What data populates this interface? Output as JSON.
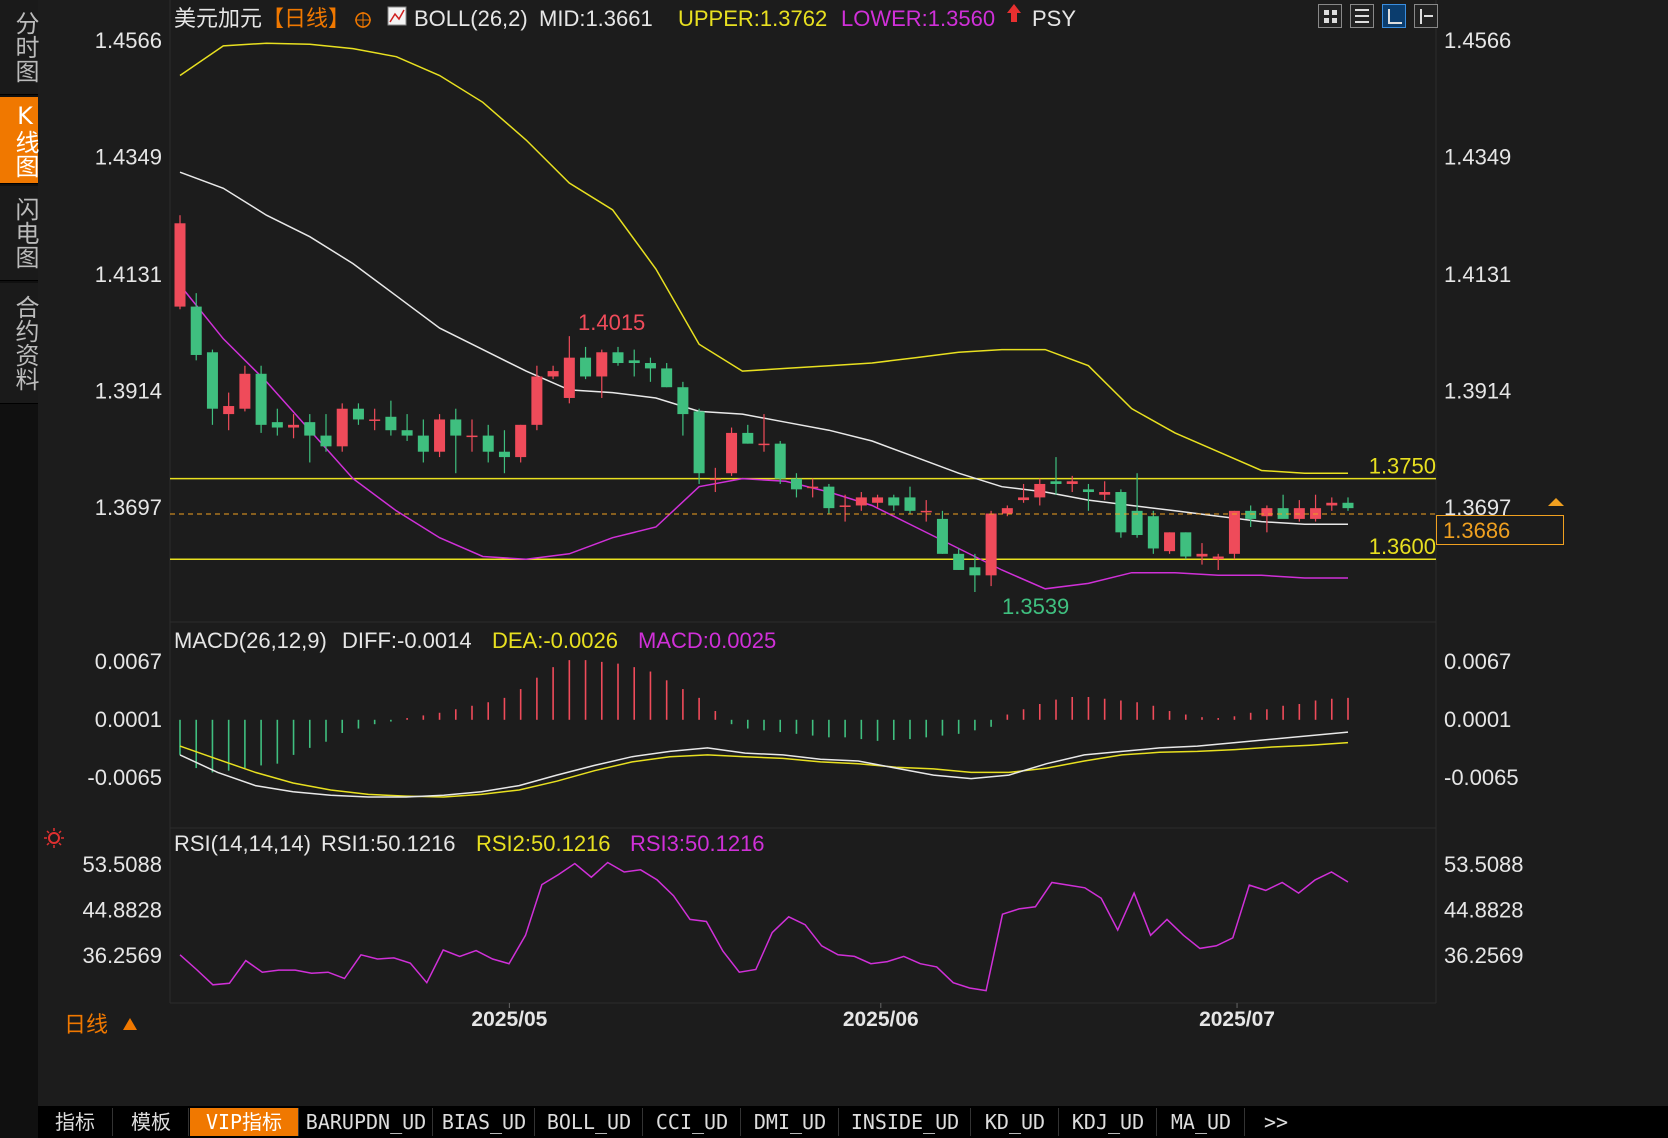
{
  "sidebar": {
    "tabs": [
      {
        "label": "分时图",
        "active": false
      },
      {
        "label": "K线图",
        "active": true
      },
      {
        "label": "闪电图",
        "active": false
      },
      {
        "label": "合约资料",
        "active": false
      }
    ]
  },
  "header": {
    "symbol": "美元加元",
    "period": "【日线】",
    "boll_label": "BOLL(26,2)",
    "mid": "MID:1.3661",
    "upper": "UPPER:1.3762",
    "lower": "LOWER:1.3560",
    "indicator": "PSY"
  },
  "colors": {
    "up": "#ef4b5a",
    "down": "#3fbf7f",
    "upper_band": "#e8e020",
    "lower_band": "#d030d8",
    "mid_band": "#e8e8e8",
    "accent": "#f07800",
    "hline": "#e8e020"
  },
  "price_axis": {
    "ticks": [
      "1.4566",
      "1.4349",
      "1.4131",
      "1.3914",
      "1.3697"
    ],
    "current": "1.3686",
    "levels": [
      "1.3750",
      "1.3600"
    ],
    "high_label": "1.4015",
    "low_label": "1.3539"
  },
  "macd": {
    "label": "MACD(26,12,9)",
    "diff": "DIFF:-0.0014",
    "dea": "DEA:-0.0026",
    "macd": "MACD:0.0025",
    "ticks": [
      "0.0067",
      "0.0001",
      "-0.0065"
    ]
  },
  "rsi": {
    "label": "RSI(14,14,14)",
    "rsi1": "RSI1:50.1216",
    "rsi2": "RSI2:50.1216",
    "rsi3": "RSI3:50.1216",
    "ticks": [
      "53.5088",
      "44.8828",
      "36.2569"
    ]
  },
  "time_axis": {
    "labels": [
      "2025/05",
      "2025/06",
      "2025/07"
    ],
    "period_label": "日线",
    "period_icon": "triangle-up-icon"
  },
  "bottom_tabs": [
    "指标",
    "模板",
    "VIP指标",
    "BARUPDN_UD",
    "BIAS_UD",
    "BOLL_UD",
    "CCI_UD",
    "DMI_UD",
    "INSIDE_UD",
    "KD_UD",
    "KDJ_UD",
    "MA_UD",
    ">>"
  ],
  "toolbar_icons": [
    "grid-icon",
    "layout-icon",
    "chart-mode-icon",
    "expand-icon"
  ],
  "chart_data": [
    {
      "type": "candlestick",
      "title": "美元加元 日线",
      "ylim": [
        1.3539,
        1.4566
      ],
      "x_labels": [
        "2025/05",
        "2025/06",
        "2025/07"
      ],
      "candles": [
        {
          "o": 1.407,
          "h": 1.424,
          "l": 1.4065,
          "c": 1.4225
        },
        {
          "o": 1.407,
          "h": 1.4095,
          "l": 1.397,
          "c": 1.398
        },
        {
          "o": 1.3985,
          "h": 1.399,
          "l": 1.385,
          "c": 1.388
        },
        {
          "o": 1.387,
          "h": 1.391,
          "l": 1.384,
          "c": 1.3885
        },
        {
          "o": 1.388,
          "h": 1.396,
          "l": 1.3875,
          "c": 1.3945
        },
        {
          "o": 1.3945,
          "h": 1.396,
          "l": 1.3835,
          "c": 1.385
        },
        {
          "o": 1.3855,
          "h": 1.388,
          "l": 1.383,
          "c": 1.3845
        },
        {
          "o": 1.3845,
          "h": 1.387,
          "l": 1.3825,
          "c": 1.385
        },
        {
          "o": 1.3855,
          "h": 1.387,
          "l": 1.378,
          "c": 1.383
        },
        {
          "o": 1.383,
          "h": 1.387,
          "l": 1.38,
          "c": 1.381
        },
        {
          "o": 1.381,
          "h": 1.389,
          "l": 1.38,
          "c": 1.388
        },
        {
          "o": 1.388,
          "h": 1.389,
          "l": 1.385,
          "c": 1.386
        },
        {
          "o": 1.386,
          "h": 1.388,
          "l": 1.384,
          "c": 1.386
        },
        {
          "o": 1.3865,
          "h": 1.3895,
          "l": 1.383,
          "c": 1.384
        },
        {
          "o": 1.384,
          "h": 1.387,
          "l": 1.382,
          "c": 1.383
        },
        {
          "o": 1.383,
          "h": 1.386,
          "l": 1.378,
          "c": 1.38
        },
        {
          "o": 1.38,
          "h": 1.387,
          "l": 1.379,
          "c": 1.386
        },
        {
          "o": 1.386,
          "h": 1.388,
          "l": 1.376,
          "c": 1.383
        },
        {
          "o": 1.383,
          "h": 1.386,
          "l": 1.38,
          "c": 1.383
        },
        {
          "o": 1.383,
          "h": 1.385,
          "l": 1.378,
          "c": 1.38
        },
        {
          "o": 1.38,
          "h": 1.384,
          "l": 1.376,
          "c": 1.379
        },
        {
          "o": 1.379,
          "h": 1.385,
          "l": 1.378,
          "c": 1.385
        },
        {
          "o": 1.385,
          "h": 1.396,
          "l": 1.384,
          "c": 1.394
        },
        {
          "o": 1.394,
          "h": 1.396,
          "l": 1.3935,
          "c": 1.395
        },
        {
          "o": 1.39,
          "h": 1.4015,
          "l": 1.389,
          "c": 1.3975
        },
        {
          "o": 1.3975,
          "h": 1.3995,
          "l": 1.3935,
          "c": 1.394
        },
        {
          "o": 1.394,
          "h": 1.399,
          "l": 1.39,
          "c": 1.3985
        },
        {
          "o": 1.3985,
          "h": 1.3995,
          "l": 1.396,
          "c": 1.3965
        },
        {
          "o": 1.397,
          "h": 1.399,
          "l": 1.394,
          "c": 1.3965
        },
        {
          "o": 1.3965,
          "h": 1.3975,
          "l": 1.393,
          "c": 1.3955
        },
        {
          "o": 1.3955,
          "h": 1.3965,
          "l": 1.392,
          "c": 1.392
        },
        {
          "o": 1.392,
          "h": 1.393,
          "l": 1.383,
          "c": 1.387
        },
        {
          "o": 1.3875,
          "h": 1.388,
          "l": 1.374,
          "c": 1.376
        },
        {
          "o": 1.375,
          "h": 1.377,
          "l": 1.3725,
          "c": 1.375
        },
        {
          "o": 1.376,
          "h": 1.3845,
          "l": 1.3755,
          "c": 1.3835
        },
        {
          "o": 1.3835,
          "h": 1.385,
          "l": 1.3815,
          "c": 1.3815
        },
        {
          "o": 1.3815,
          "h": 1.387,
          "l": 1.38,
          "c": 1.3815
        },
        {
          "o": 1.3815,
          "h": 1.382,
          "l": 1.374,
          "c": 1.375
        },
        {
          "o": 1.375,
          "h": 1.376,
          "l": 1.3715,
          "c": 1.373
        },
        {
          "o": 1.3735,
          "h": 1.375,
          "l": 1.3715,
          "c": 1.3735
        },
        {
          "o": 1.3735,
          "h": 1.374,
          "l": 1.3685,
          "c": 1.3695
        },
        {
          "o": 1.37,
          "h": 1.372,
          "l": 1.367,
          "c": 1.37
        },
        {
          "o": 1.37,
          "h": 1.3725,
          "l": 1.369,
          "c": 1.3715
        },
        {
          "o": 1.3705,
          "h": 1.372,
          "l": 1.3695,
          "c": 1.3715
        },
        {
          "o": 1.3715,
          "h": 1.372,
          "l": 1.369,
          "c": 1.37
        },
        {
          "o": 1.3715,
          "h": 1.3735,
          "l": 1.3685,
          "c": 1.369
        },
        {
          "o": 1.369,
          "h": 1.371,
          "l": 1.367,
          "c": 1.369
        },
        {
          "o": 1.3675,
          "h": 1.369,
          "l": 1.361,
          "c": 1.361
        },
        {
          "o": 1.361,
          "h": 1.362,
          "l": 1.358,
          "c": 1.358
        },
        {
          "o": 1.3585,
          "h": 1.361,
          "l": 1.3539,
          "c": 1.357
        },
        {
          "o": 1.357,
          "h": 1.369,
          "l": 1.355,
          "c": 1.3685
        },
        {
          "o": 1.3685,
          "h": 1.37,
          "l": 1.368,
          "c": 1.3695
        },
        {
          "o": 1.371,
          "h": 1.374,
          "l": 1.3705,
          "c": 1.3715
        },
        {
          "o": 1.3715,
          "h": 1.375,
          "l": 1.37,
          "c": 1.374
        },
        {
          "o": 1.3745,
          "h": 1.379,
          "l": 1.372,
          "c": 1.374
        },
        {
          "o": 1.374,
          "h": 1.3755,
          "l": 1.3725,
          "c": 1.3745
        },
        {
          "o": 1.373,
          "h": 1.374,
          "l": 1.369,
          "c": 1.3725
        },
        {
          "o": 1.372,
          "h": 1.3745,
          "l": 1.371,
          "c": 1.3725
        },
        {
          "o": 1.3725,
          "h": 1.373,
          "l": 1.364,
          "c": 1.365
        },
        {
          "o": 1.369,
          "h": 1.376,
          "l": 1.364,
          "c": 1.3645
        },
        {
          "o": 1.368,
          "h": 1.369,
          "l": 1.361,
          "c": 1.362
        },
        {
          "o": 1.3615,
          "h": 1.365,
          "l": 1.361,
          "c": 1.365
        },
        {
          "o": 1.365,
          "h": 1.365,
          "l": 1.36,
          "c": 1.3605
        },
        {
          "o": 1.3605,
          "h": 1.363,
          "l": 1.359,
          "c": 1.361
        },
        {
          "o": 1.36,
          "h": 1.361,
          "l": 1.358,
          "c": 1.3605
        },
        {
          "o": 1.361,
          "h": 1.369,
          "l": 1.36,
          "c": 1.369
        },
        {
          "o": 1.369,
          "h": 1.37,
          "l": 1.366,
          "c": 1.3675
        },
        {
          "o": 1.368,
          "h": 1.37,
          "l": 1.365,
          "c": 1.3695
        },
        {
          "o": 1.3695,
          "h": 1.372,
          "l": 1.368,
          "c": 1.3675
        },
        {
          "o": 1.3675,
          "h": 1.371,
          "l": 1.367,
          "c": 1.3695
        },
        {
          "o": 1.3675,
          "h": 1.372,
          "l": 1.367,
          "c": 1.3695
        },
        {
          "o": 1.37,
          "h": 1.3715,
          "l": 1.369,
          "c": 1.3705
        },
        {
          "o": 1.3705,
          "h": 1.3715,
          "l": 1.369,
          "c": 1.3695
        }
      ],
      "bands": {
        "upper": [
          1.45,
          1.4555,
          1.456,
          1.4558,
          1.455,
          1.4535,
          1.45,
          1.445,
          1.438,
          1.43,
          1.425,
          1.414,
          1.4,
          1.395,
          1.3955,
          1.396,
          1.3965,
          1.3975,
          1.3985,
          1.399,
          1.399,
          1.396,
          1.388,
          1.3835,
          1.38,
          1.3765,
          1.376,
          1.376
        ],
        "mid": [
          1.432,
          1.429,
          1.424,
          1.42,
          1.415,
          1.409,
          1.403,
          1.399,
          1.395,
          1.3915,
          1.391,
          1.39,
          1.3875,
          1.387,
          1.3855,
          1.384,
          1.382,
          1.379,
          1.376,
          1.3735,
          1.3725,
          1.371,
          1.37,
          1.369,
          1.368,
          1.367,
          1.3665,
          1.3665
        ],
        "lower": [
          1.411,
          1.401,
          1.393,
          1.384,
          1.375,
          1.369,
          1.364,
          1.3605,
          1.36,
          1.361,
          1.364,
          1.366,
          1.3735,
          1.375,
          1.3745,
          1.3725,
          1.37,
          1.366,
          1.362,
          1.358,
          1.3545,
          1.3555,
          1.3575,
          1.3575,
          1.357,
          1.357,
          1.3565,
          1.3565
        ]
      },
      "hlines": [
        1.375,
        1.36
      ],
      "current_price": 1.3686
    },
    {
      "type": "bar",
      "title": "MACD(26,12,9)",
      "ylim": [
        -0.008,
        0.0067
      ],
      "macd_hist": [
        -0.004,
        -0.0055,
        -0.006,
        -0.0058,
        -0.0055,
        -0.0052,
        -0.005,
        -0.004,
        -0.0032,
        -0.0025,
        -0.0015,
        -0.001,
        -0.0005,
        -0.0002,
        0.0002,
        0.0005,
        0.0008,
        0.0012,
        0.0016,
        0.002,
        0.0025,
        0.0035,
        0.0048,
        0.006,
        0.0068,
        0.0068,
        0.0066,
        0.0064,
        0.006,
        0.0055,
        0.0045,
        0.0035,
        0.0025,
        0.001,
        -0.0005,
        -0.001,
        -0.0012,
        -0.0014,
        -0.0016,
        -0.0018,
        -0.002,
        -0.002,
        -0.0022,
        -0.0024,
        -0.0023,
        -0.0022,
        -0.002,
        -0.0018,
        -0.0016,
        -0.0012,
        -0.0008,
        0.0006,
        0.0012,
        0.0018,
        0.0023,
        0.0026,
        0.0026,
        0.0024,
        0.0022,
        0.002,
        0.0016,
        0.001,
        0.0006,
        0.0003,
        0.0002,
        0.0004,
        0.0008,
        0.0012,
        0.0016,
        0.0018,
        0.0022,
        0.0024,
        0.0025
      ],
      "diff": [
        -0.004,
        -0.006,
        -0.0075,
        -0.0082,
        -0.0086,
        -0.0088,
        -0.0088,
        -0.0086,
        -0.0082,
        -0.0075,
        -0.0063,
        -0.0052,
        -0.0042,
        -0.0036,
        -0.0032,
        -0.0038,
        -0.004,
        -0.0045,
        -0.0047,
        -0.0055,
        -0.0063,
        -0.0067,
        -0.0063,
        -0.005,
        -0.004,
        -0.0036,
        -0.0032,
        -0.003,
        -0.0026,
        -0.0022,
        -0.0018,
        -0.0014
      ],
      "dea": [
        -0.003,
        -0.0045,
        -0.006,
        -0.0072,
        -0.008,
        -0.0085,
        -0.0087,
        -0.0088,
        -0.0085,
        -0.008,
        -0.007,
        -0.0058,
        -0.0048,
        -0.0042,
        -0.004,
        -0.0042,
        -0.0044,
        -0.0048,
        -0.005,
        -0.0054,
        -0.0056,
        -0.006,
        -0.006,
        -0.0055,
        -0.0047,
        -0.004,
        -0.0037,
        -0.0036,
        -0.0034,
        -0.0031,
        -0.0029,
        -0.0026
      ]
    },
    {
      "type": "line",
      "title": "RSI(14,14,14)",
      "ylim": [
        29.0,
        56.0
      ],
      "series": [
        {
          "name": "RSI1",
          "values": [
            36.3,
            33.5,
            30.6,
            30.9,
            35.2,
            33.0,
            33.4,
            33.4,
            32.8,
            33.0,
            31.8,
            36.3,
            35.5,
            35.7,
            34.7,
            31.0,
            37.2,
            36.0,
            37.1,
            35.5,
            34.6,
            40.0,
            49.6,
            51.5,
            53.6,
            51.0,
            53.8,
            52.0,
            52.4,
            50.5,
            47.5,
            43.0,
            42.6,
            37.0,
            33.0,
            33.5,
            40.5,
            43.5,
            42.0,
            38.0,
            36.3,
            36.0,
            34.6,
            35.0,
            36.0,
            34.6,
            34.0,
            31.0,
            30.0,
            29.5,
            44.0,
            45.0,
            45.4,
            50.0,
            49.5,
            49.0,
            47.0,
            41.0,
            48.0,
            40.0,
            43.0,
            40.0,
            37.5,
            38.0,
            39.5,
            49.5,
            48.5,
            50.0,
            48.0,
            50.5,
            52.0,
            50.1
          ]
        }
      ]
    }
  ]
}
